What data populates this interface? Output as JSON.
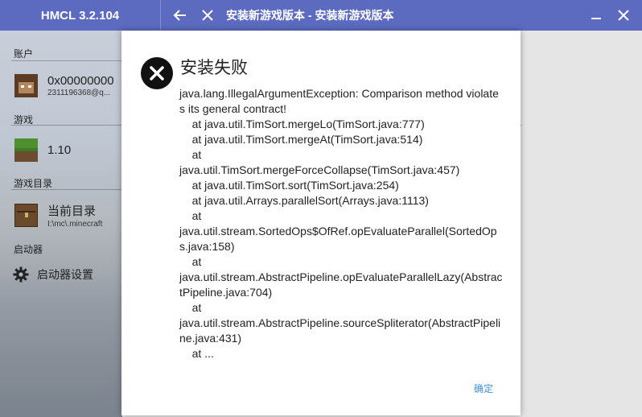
{
  "titlebar": {
    "app_name": "HMCL 3.2.104",
    "page_title": "安装新游戏版本 - 安装新游戏版本"
  },
  "sidebar": {
    "account_section": "账户",
    "account": {
      "name": "0x00000000",
      "email": "2311196368@q..."
    },
    "game_section": "游戏",
    "game": {
      "version": "1.10"
    },
    "dir_section": "游戏目录",
    "directory": {
      "name": "当前目录",
      "path": "I:\\mc\\.minecraft"
    },
    "launcher_section": "启动器",
    "settings_label": "启动器设置"
  },
  "dialog": {
    "title": "安装失败",
    "message": "java.lang.IllegalArgumentException: Comparison method violates its general contract!\n\tat java.util.TimSort.mergeLo(TimSort.java:777)\n\tat java.util.TimSort.mergeAt(TimSort.java:514)\n\tat\njava.util.TimSort.mergeForceCollapse(TimSort.java:457)\n\tat java.util.TimSort.sort(TimSort.java:254)\n\tat java.util.Arrays.parallelSort(Arrays.java:1113)\n\tat\njava.util.stream.SortedOps$OfRef.opEvaluateParallel(SortedOps.java:158)\n\tat\njava.util.stream.AbstractPipeline.opEvaluateParallelLazy(AbstractPipeline.java:704)\n\tat\njava.util.stream.AbstractPipeline.sourceSpliterator(AbstractPipeline.java:431)\n\tat ...",
    "ok_label": "确定"
  },
  "colors": {
    "titlebar": "#5c6bc0",
    "accent_link": "#3f8fcf"
  }
}
